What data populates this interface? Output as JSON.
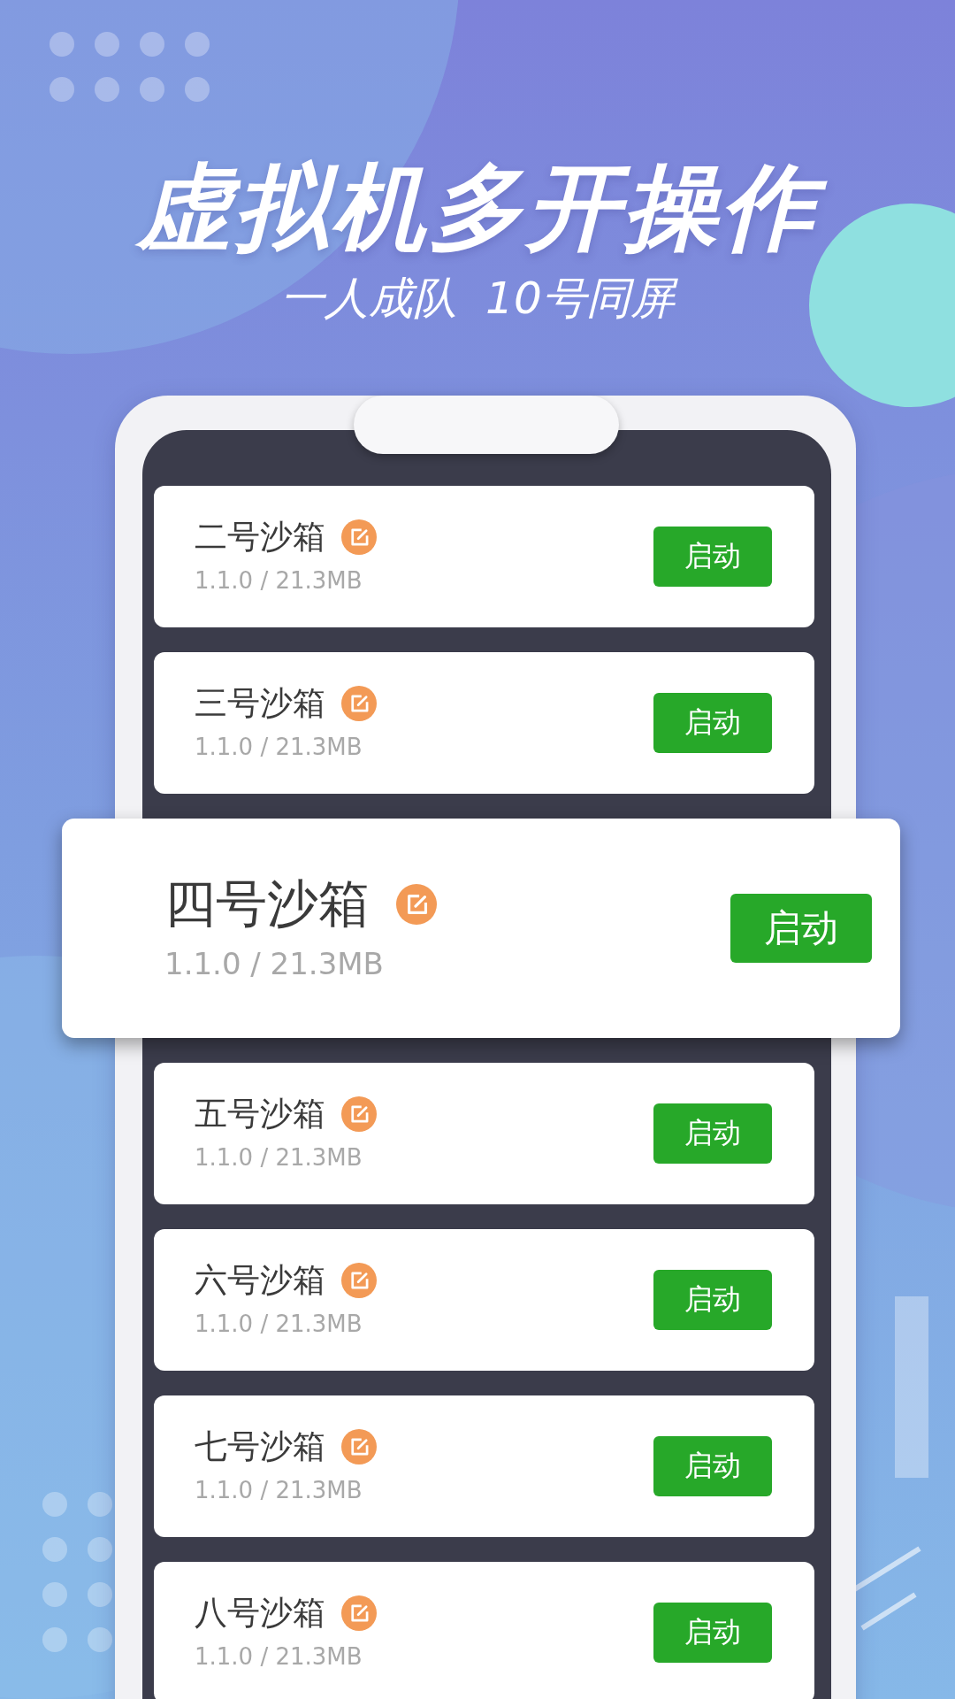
{
  "headline": {
    "title": "虚拟机多开操作",
    "subtitle": "一人成队  10号同屏"
  },
  "sandboxes": [
    {
      "kind": "normal",
      "name": "二号沙箱",
      "version": "1.1.0 / 21.3MB",
      "button": "启动"
    },
    {
      "kind": "normal",
      "name": "三号沙箱",
      "version": "1.1.0 / 21.3MB",
      "button": "启动"
    },
    {
      "kind": "featured",
      "name": "四号沙箱",
      "version": "1.1.0 / 21.3MB",
      "button": "启动"
    },
    {
      "kind": "normal",
      "name": "五号沙箱",
      "version": "1.1.0 / 21.3MB",
      "button": "启动"
    },
    {
      "kind": "normal",
      "name": "六号沙箱",
      "version": "1.1.0 / 21.3MB",
      "button": "启动"
    },
    {
      "kind": "normal",
      "name": "七号沙箱",
      "version": "1.1.0 / 21.3MB",
      "button": "启动"
    },
    {
      "kind": "normal",
      "name": "八号沙箱",
      "version": "1.1.0 / 21.3MB",
      "button": "启动"
    }
  ]
}
